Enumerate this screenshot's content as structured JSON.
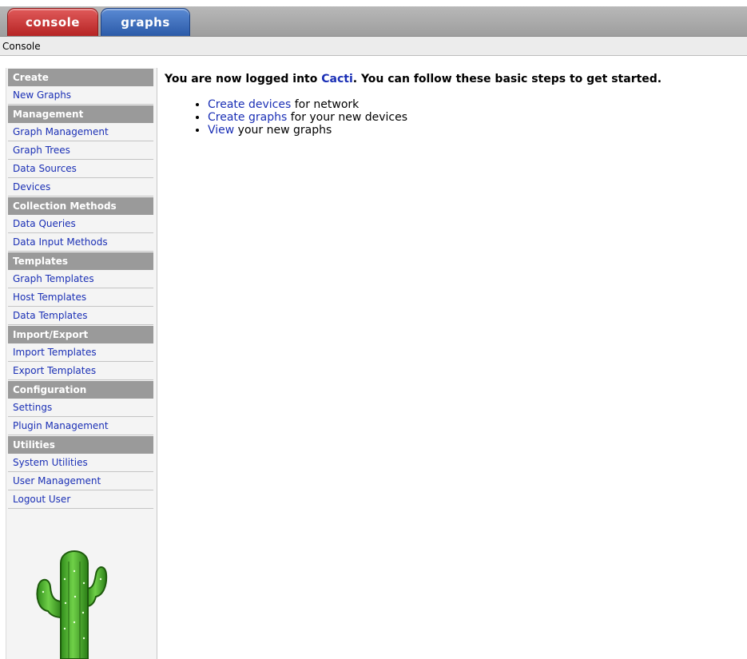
{
  "tabs": {
    "console": "console",
    "graphs": "graphs"
  },
  "breadcrumb": "Console",
  "welcome": {
    "prefix": "You are now logged into ",
    "link": "Cacti",
    "suffix": ". You can follow these basic steps to get started."
  },
  "steps": [
    {
      "link": "Create devices",
      "text": " for network"
    },
    {
      "link": "Create graphs",
      "text": " for your new devices"
    },
    {
      "link": "View",
      "text": " your new graphs"
    }
  ],
  "sidebar": {
    "create": {
      "header": "Create",
      "items": [
        "New Graphs"
      ]
    },
    "management": {
      "header": "Management",
      "items": [
        "Graph Management",
        "Graph Trees",
        "Data Sources",
        "Devices"
      ]
    },
    "collection": {
      "header": "Collection Methods",
      "items": [
        "Data Queries",
        "Data Input Methods"
      ]
    },
    "templates": {
      "header": "Templates",
      "items": [
        "Graph Templates",
        "Host Templates",
        "Data Templates"
      ]
    },
    "importexport": {
      "header": "Import/Export",
      "items": [
        "Import Templates",
        "Export Templates"
      ]
    },
    "configuration": {
      "header": "Configuration",
      "items": [
        "Settings",
        "Plugin Management"
      ]
    },
    "utilities": {
      "header": "Utilities",
      "items": [
        "System Utilities",
        "User Management",
        "Logout User"
      ]
    }
  },
  "colors": {
    "console_tab": "#c83030",
    "graphs_tab": "#3a6cc0",
    "link": "#1a2fb5",
    "menu_header": "#9a9a9a",
    "cactus": "#4cae2c"
  },
  "icons": {
    "logo": "cacti-cactus-logo"
  }
}
